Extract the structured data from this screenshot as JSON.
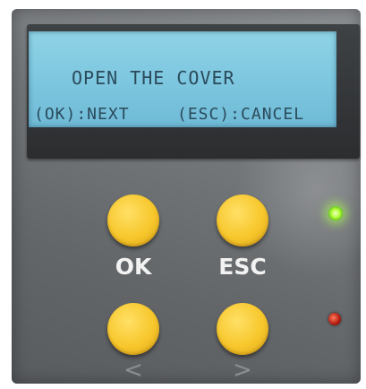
{
  "lcd": {
    "line1": "OPEN THE COVER",
    "next_hint": "(OK):NEXT",
    "cancel_hint": "(ESC):CANCEL"
  },
  "buttons": {
    "ok_label": "OK",
    "esc_label": "ESC",
    "prev_label": "<",
    "next_label": ">"
  },
  "indicators": {
    "status_led": "green-on",
    "error_led": "red-off"
  },
  "colors": {
    "lcd_background": "#7cc6df",
    "lcd_text": "#2b4a5b",
    "button_yellow": "#f7c72c",
    "panel_gray": "#6b6e71"
  }
}
